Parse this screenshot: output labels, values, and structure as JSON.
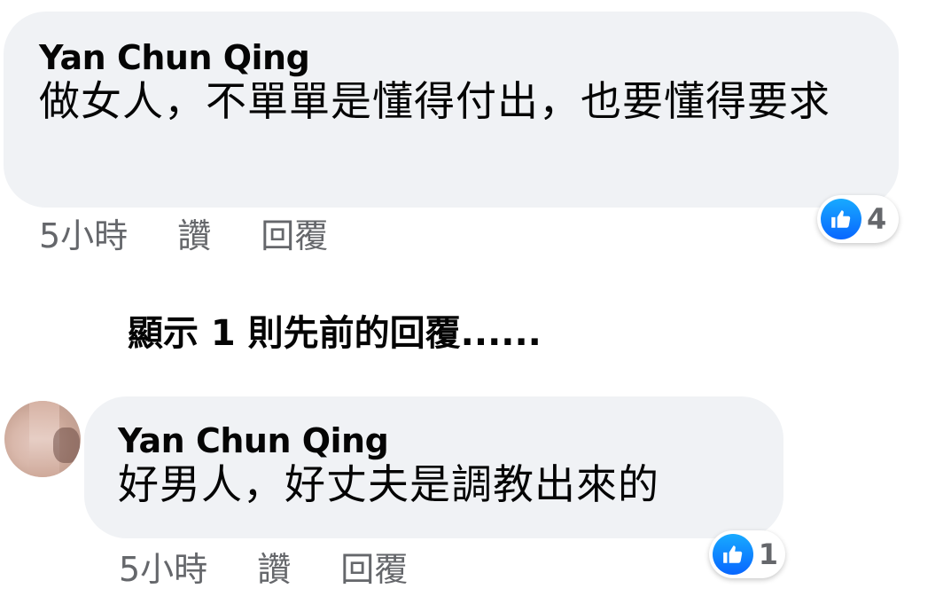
{
  "comments": [
    {
      "author": "Yan Chun Qing",
      "text": "做女人，不單單是懂得付出，也要懂得要求",
      "time": "5小時",
      "like_label": "讚",
      "reply_label": "回覆",
      "reaction_count": "4",
      "reaction_icon": "thumbs-up-icon",
      "reaction_color": "#0866ff"
    },
    {
      "author": "Yan Chun Qing",
      "text": "好男人，好丈夫是調教出來的",
      "time": "5小時",
      "like_label": "讚",
      "reply_label": "回覆",
      "reaction_count": "1",
      "reaction_icon": "thumbs-up-icon",
      "reaction_color": "#0866ff"
    }
  ],
  "previous_replies_label": "顯示 1 則先前的回覆......",
  "colors": {
    "bubble_bg": "#f0f2f5",
    "meta_text": "#65676b",
    "primary_text": "#050505",
    "like_blue": "#0866ff"
  }
}
